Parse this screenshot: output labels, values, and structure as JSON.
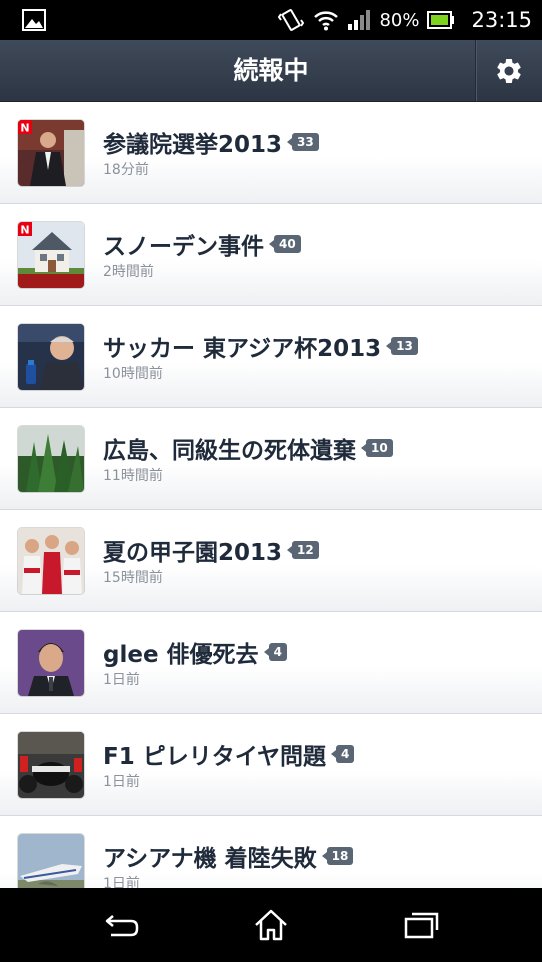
{
  "status_bar": {
    "battery_percent": "80%",
    "time": "23:15"
  },
  "header": {
    "title": "続報中",
    "settings_icon": "gear-icon"
  },
  "items": [
    {
      "title": "参議院選挙2013",
      "count": "33",
      "time": "18分前"
    },
    {
      "title": "スノーデン事件",
      "count": "40",
      "time": "2時間前"
    },
    {
      "title": "サッカー 東アジア杯2013",
      "count": "13",
      "time": "10時間前"
    },
    {
      "title": "広島、同級生の死体遺棄",
      "count": "10",
      "time": "11時間前"
    },
    {
      "title": "夏の甲子園2013",
      "count": "12",
      "time": "15時間前"
    },
    {
      "title": "glee 俳優死去",
      "count": "4",
      "time": "1日前"
    },
    {
      "title": "F1 ピレリタイヤ問題",
      "count": "4",
      "time": "1日前"
    },
    {
      "title": "アシアナ機 着陸失敗",
      "count": "18",
      "time": "1日前"
    }
  ],
  "nav_bar": {
    "back_icon": "back-icon",
    "home_icon": "home-icon",
    "recents_icon": "recents-icon"
  }
}
